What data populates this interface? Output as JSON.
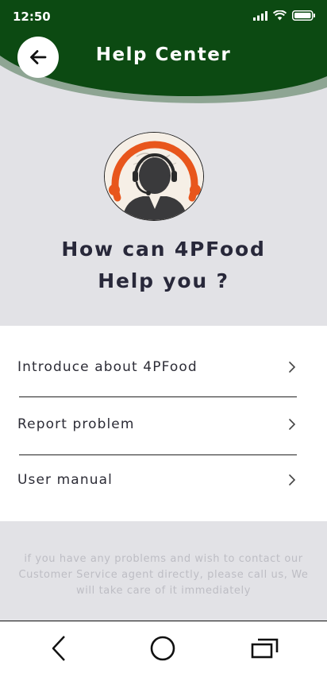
{
  "status_bar": {
    "time": "12:50",
    "icons": [
      "signal-icon",
      "wifi-icon",
      "battery-icon"
    ]
  },
  "header": {
    "title": "Help Center",
    "back_icon": "arrow-left-icon"
  },
  "colors": {
    "header_green": "#0c4a12",
    "wave_light": "#8ea593",
    "background": "#e2e2e6",
    "title_text": "#28283a"
  },
  "hero": {
    "title_line1": "How can 4PFood",
    "title_line2": "Help you ?"
  },
  "menu": {
    "items": [
      {
        "label": "Introduce about 4PFood",
        "icon": "chevron-right-icon"
      },
      {
        "label": "Report problem",
        "icon": "chevron-right-icon"
      },
      {
        "label": "User manual",
        "icon": "chevron-right-icon"
      }
    ]
  },
  "help_note": "if you have any problems and wish to contact our Customer Service agent directly, please call us, We will take care of it immediately",
  "navbar": {
    "buttons": [
      "back-nav-icon",
      "home-nav-icon",
      "recents-nav-icon"
    ]
  }
}
